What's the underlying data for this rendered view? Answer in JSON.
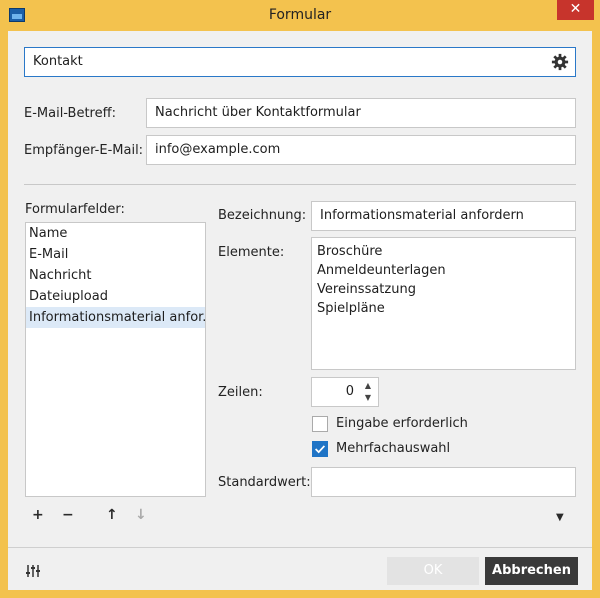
{
  "window": {
    "title": "Formular",
    "close_glyph": "✕"
  },
  "form_name": {
    "value": "Kontakt"
  },
  "labels": {
    "subject": "E-Mail-Betreff:",
    "recipient": "Empfänger-E-Mail:",
    "fields": "Formularfelder:",
    "designation": "Bezeichnung:",
    "elements": "Elemente:",
    "rows": "Zeilen:",
    "required": "Eingabe erforderlich",
    "multiple": "Mehrfachauswahl",
    "default": "Standardwert:"
  },
  "values": {
    "subject": "Nachricht über Kontaktformular",
    "recipient": "info@example.com",
    "designation": "Informationsmaterial anfordern",
    "rows": "0",
    "default": ""
  },
  "fields": [
    "Name",
    "E-Mail",
    "Nachricht",
    "Dateiupload",
    "Informationsmaterial anfor..."
  ],
  "elements": [
    "Broschüre",
    "Anmeldeunterlagen",
    "Vereinssatzung",
    "Spielpläne"
  ],
  "checkboxes": {
    "required": false,
    "multiple": true
  },
  "toolbar": {
    "add": "+",
    "remove": "−",
    "up": "↑",
    "down": "↓",
    "menu": "▼"
  },
  "buttons": {
    "ok": "OK",
    "cancel": "Abbrechen"
  },
  "icons": {
    "settings": "gear-icon",
    "adjust": "sliders-icon"
  },
  "colors": {
    "titlebar": "#f3c24e",
    "accent": "#1f74c6",
    "close": "#c7342c"
  }
}
